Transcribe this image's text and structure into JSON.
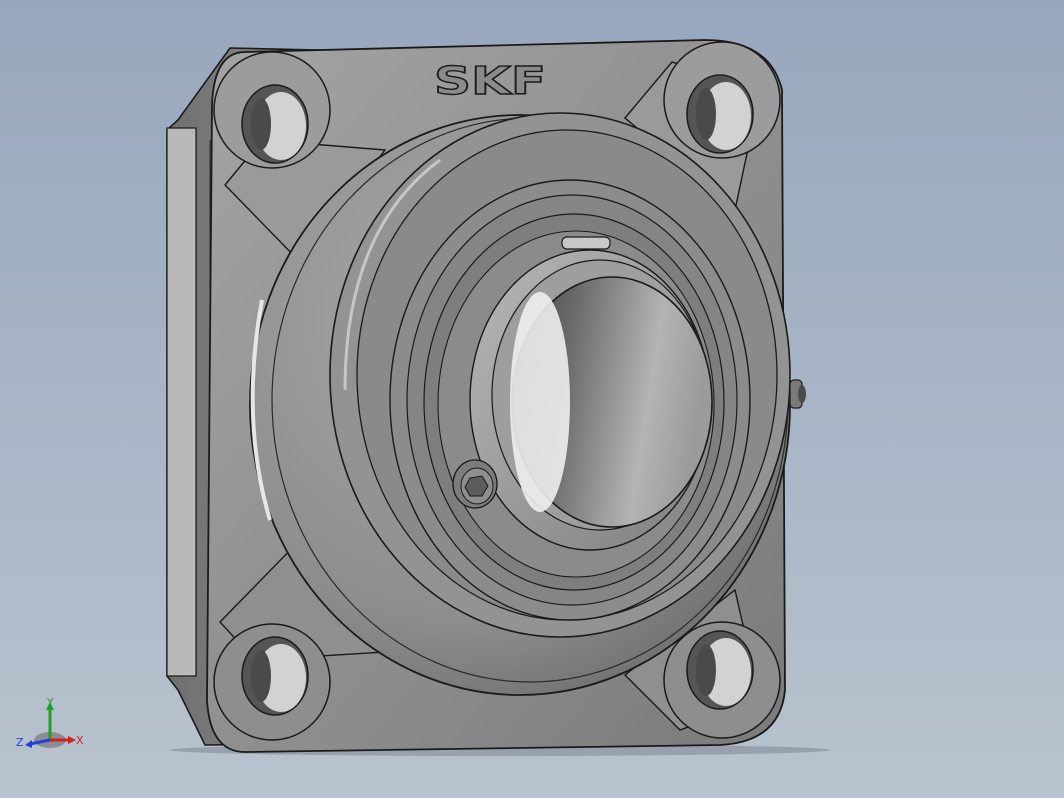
{
  "viewport": {
    "background_top": "#97a7bd",
    "background_bottom": "#b9c3cf"
  },
  "model": {
    "brand_text": "SKF",
    "body_color": "#8e8e8e",
    "edge_color": "#1a1a1a"
  },
  "triad": {
    "x_label": "X",
    "y_label": "Y",
    "z_label": "Z",
    "x_color": "#d42020",
    "y_color": "#1fa01f",
    "z_color": "#2a3fd8"
  }
}
